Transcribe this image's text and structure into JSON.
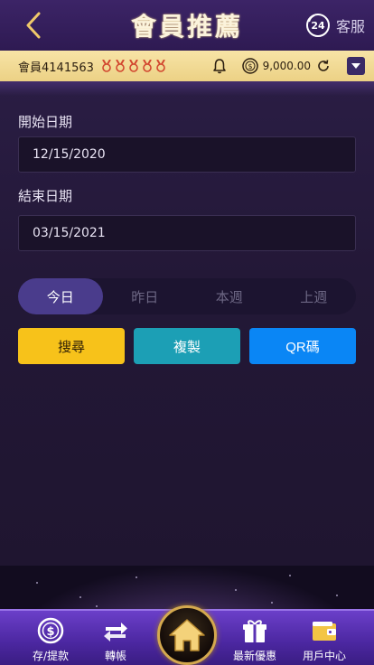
{
  "header": {
    "title": "會員推薦",
    "customer_service_label": "客服",
    "customer_service_badge": "24"
  },
  "member_bar": {
    "member_name": "會員4141563",
    "medal_count": 5,
    "balance": "9,000.00"
  },
  "form": {
    "start_label": "開始日期",
    "start_value": "12/15/2020",
    "end_label": "結束日期",
    "end_value": "03/15/2021"
  },
  "range_tabs": [
    {
      "label": "今日",
      "active": true
    },
    {
      "label": "昨日",
      "active": false
    },
    {
      "label": "本週",
      "active": false
    },
    {
      "label": "上週",
      "active": false
    }
  ],
  "actions": {
    "search": "搜尋",
    "copy": "複製",
    "qr": "QR碼"
  },
  "bottom_nav": [
    {
      "label": "存/提款",
      "icon": "deposit-withdraw-icon"
    },
    {
      "label": "轉帳",
      "icon": "transfer-icon"
    },
    {
      "label": "",
      "icon": "home-icon"
    },
    {
      "label": "最新優惠",
      "icon": "gift-icon"
    },
    {
      "label": "用戶中心",
      "icon": "wallet-icon"
    }
  ],
  "colors": {
    "gold_bar": "#ecd185",
    "active_tab": "#4a3c8c",
    "search_btn": "#f7c21a",
    "copy_btn": "#1c9fb5",
    "qr_btn": "#0a86f5",
    "nav_purple": "#5a32b4"
  }
}
